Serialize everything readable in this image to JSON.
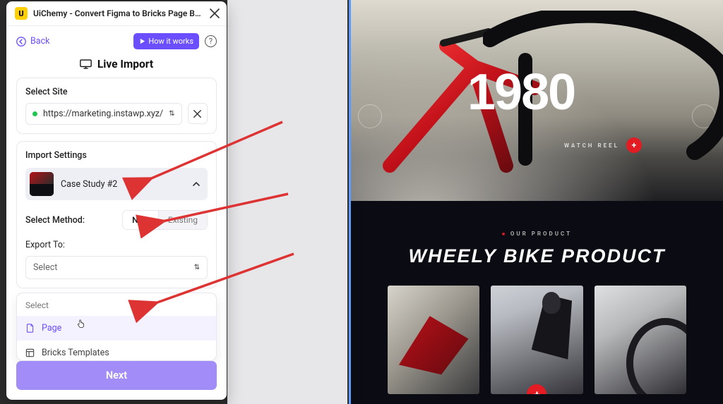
{
  "window": {
    "app_badge": "U",
    "title": "UiChemy - Convert Figma to Bricks Page Builder ( ..."
  },
  "toolbar": {
    "back": "Back",
    "how_it_works": "How it works",
    "help": "?"
  },
  "heading": "Live Import",
  "site": {
    "label": "Select Site",
    "url": "https://marketing.instawp.xyz/"
  },
  "import": {
    "title": "Import Settings",
    "case_name": "Case Study #2",
    "method_label": "Select Method:",
    "method_new": "New",
    "method_existing": "Existing",
    "export_label": "Export To:",
    "select_placeholder": "Select"
  },
  "dropdown": {
    "header": "Select",
    "page": "Page",
    "bricks": "Bricks Templates"
  },
  "next": "Next",
  "preview": {
    "hero_year": "1980",
    "watch": "WATCH REEL",
    "pill": "OUR PRODUCT",
    "section_title": "WHEELY BIKE PRODUCT"
  }
}
